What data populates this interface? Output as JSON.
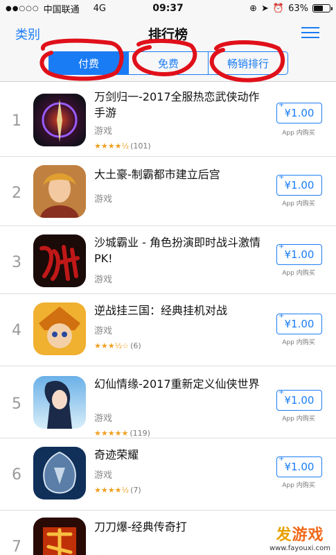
{
  "status": {
    "carrier": "中国联通",
    "network": "4G",
    "time": "09:37",
    "battery": "63%",
    "battery_level": 0.63
  },
  "nav": {
    "back_label": "类别",
    "title": "排行榜"
  },
  "tabs": [
    {
      "label": "付费",
      "active": true
    },
    {
      "label": "免费",
      "active": false
    },
    {
      "label": "畅销排行",
      "active": false
    }
  ],
  "apps": [
    {
      "rank": "1",
      "name": "万剑归一-2017全服热恋武侠动作手游",
      "category": "游戏",
      "stars": "★★★★½",
      "rating_value": 4.5,
      "ratings": "(101)",
      "price": "¥1.00",
      "iap": "App 内购买"
    },
    {
      "rank": "2",
      "name": "大土豪-制霸都市建立后宫",
      "category": "游戏",
      "stars": "",
      "rating_value": null,
      "ratings": "",
      "price": "¥1.00",
      "iap": "App 内购买"
    },
    {
      "rank": "3",
      "name": "沙城霸业 - 角色扮演即时战斗激情PK!",
      "category": "游戏",
      "stars": "",
      "rating_value": null,
      "ratings": "",
      "price": "¥1.00",
      "iap": "App 内购买"
    },
    {
      "rank": "4",
      "name": "逆战挂三国：经典挂机对战",
      "category": "游戏",
      "stars": "★★★½☆",
      "rating_value": 3.5,
      "ratings": "(6)",
      "price": "¥1.00",
      "iap": "App 内购买"
    },
    {
      "rank": "5",
      "name": "幻仙情缘-2017重新定义仙侠世界",
      "category": "游戏",
      "stars": "★★★★★",
      "rating_value": 5,
      "ratings": "(119)",
      "price": "¥1.00",
      "iap": "App 内购买"
    },
    {
      "rank": "6",
      "name": "奇迹荣耀",
      "category": "游戏",
      "stars": "★★★★½",
      "rating_value": 4.5,
      "ratings": "(7)",
      "price": "¥1.00",
      "iap": "App 内购买"
    },
    {
      "rank": "7",
      "name": "刀刀爆-经典传奇打",
      "category": "游戏",
      "stars": "",
      "rating_value": null,
      "ratings": "",
      "price": "",
      "iap": ""
    }
  ],
  "icon_names": [
    "game-icon-wanjian",
    "game-icon-datuhao",
    "game-icon-shacheng",
    "game-icon-nizhan",
    "game-icon-huanxian",
    "game-icon-qiji",
    "game-icon-daodaobao"
  ],
  "watermark": {
    "brand_a": "发",
    "brand_b": "游戏",
    "url": "www.fayouxi.com"
  },
  "colors": {
    "accent": "#1a7cf5",
    "star": "#f0a020",
    "scribble": "#e0101a"
  }
}
